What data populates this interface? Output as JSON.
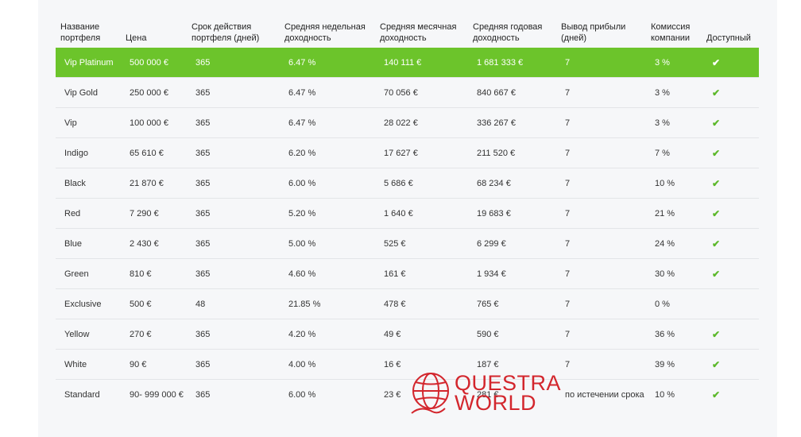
{
  "table": {
    "headers": [
      "Название портфеля",
      "Цена",
      "Срок действия портфеля (дней)",
      "Средняя недельная доходность",
      "Средняя месячная доходность",
      "Средняя годовая доходность",
      "Вывод прибыли (дней)",
      "Комиссия компании",
      "Доступный"
    ],
    "rows": [
      {
        "name": "Vip Platinum",
        "price": "500 000 €",
        "term": "365",
        "weekly": "6.47 %",
        "monthly": "140 111 €",
        "yearly": "1 681 333 €",
        "withdraw": "7",
        "commission": "3 %",
        "available": "✔"
      },
      {
        "name": "Vip Gold",
        "price": "250 000 €",
        "term": "365",
        "weekly": "6.47 %",
        "monthly": "70 056 €",
        "yearly": "840 667 €",
        "withdraw": "7",
        "commission": "3 %",
        "available": "✔"
      },
      {
        "name": "Vip",
        "price": "100 000 €",
        "term": "365",
        "weekly": "6.47 %",
        "monthly": "28 022 €",
        "yearly": "336 267 €",
        "withdraw": "7",
        "commission": "3 %",
        "available": "✔"
      },
      {
        "name": "Indigo",
        "price": "65 610 €",
        "term": "365",
        "weekly": "6.20 %",
        "monthly": "17 627 €",
        "yearly": "211 520 €",
        "withdraw": "7",
        "commission": "7 %",
        "available": "✔"
      },
      {
        "name": "Black",
        "price": "21 870 €",
        "term": "365",
        "weekly": "6.00 %",
        "monthly": "5 686 €",
        "yearly": "68 234 €",
        "withdraw": "7",
        "commission": "10 %",
        "available": "✔"
      },
      {
        "name": "Red",
        "price": "7 290 €",
        "term": "365",
        "weekly": "5.20 %",
        "monthly": "1 640 €",
        "yearly": "19 683 €",
        "withdraw": "7",
        "commission": "21 %",
        "available": "✔"
      },
      {
        "name": "Blue",
        "price": "2 430 €",
        "term": "365",
        "weekly": "5.00 %",
        "monthly": "525 €",
        "yearly": "6 299 €",
        "withdraw": "7",
        "commission": "24 %",
        "available": "✔"
      },
      {
        "name": "Green",
        "price": "810 €",
        "term": "365",
        "weekly": "4.60 %",
        "monthly": "161 €",
        "yearly": "1 934 €",
        "withdraw": "7",
        "commission": "30 %",
        "available": "✔"
      },
      {
        "name": "Exclusive",
        "price": "500 €",
        "term": "48",
        "weekly": "21.85 %",
        "monthly": "478 €",
        "yearly": "765 €",
        "withdraw": "7",
        "commission": "0 %",
        "available": ""
      },
      {
        "name": "Yellow",
        "price": "270 €",
        "term": "365",
        "weekly": "4.20 %",
        "monthly": "49 €",
        "yearly": "590 €",
        "withdraw": "7",
        "commission": "36 %",
        "available": "✔"
      },
      {
        "name": "White",
        "price": "90 €",
        "term": "365",
        "weekly": "4.00 %",
        "monthly": "16 €",
        "yearly": "187 €",
        "withdraw": "7",
        "commission": "39 %",
        "available": "✔"
      },
      {
        "name": "Standard",
        "price": "90- 999 000 €",
        "term": "365",
        "weekly": "6.00 %",
        "monthly": "23 €",
        "yearly": "281 €",
        "withdraw": "по истечении срока",
        "commission": "10 %",
        "available": "✔"
      }
    ],
    "highlight_color": "#6cc42b",
    "check_color": "#5cb82a"
  },
  "watermark": {
    "line1": "QUESTRA",
    "line2": "WORLD",
    "color": "#d3262d",
    "icon": "globe-icon"
  }
}
